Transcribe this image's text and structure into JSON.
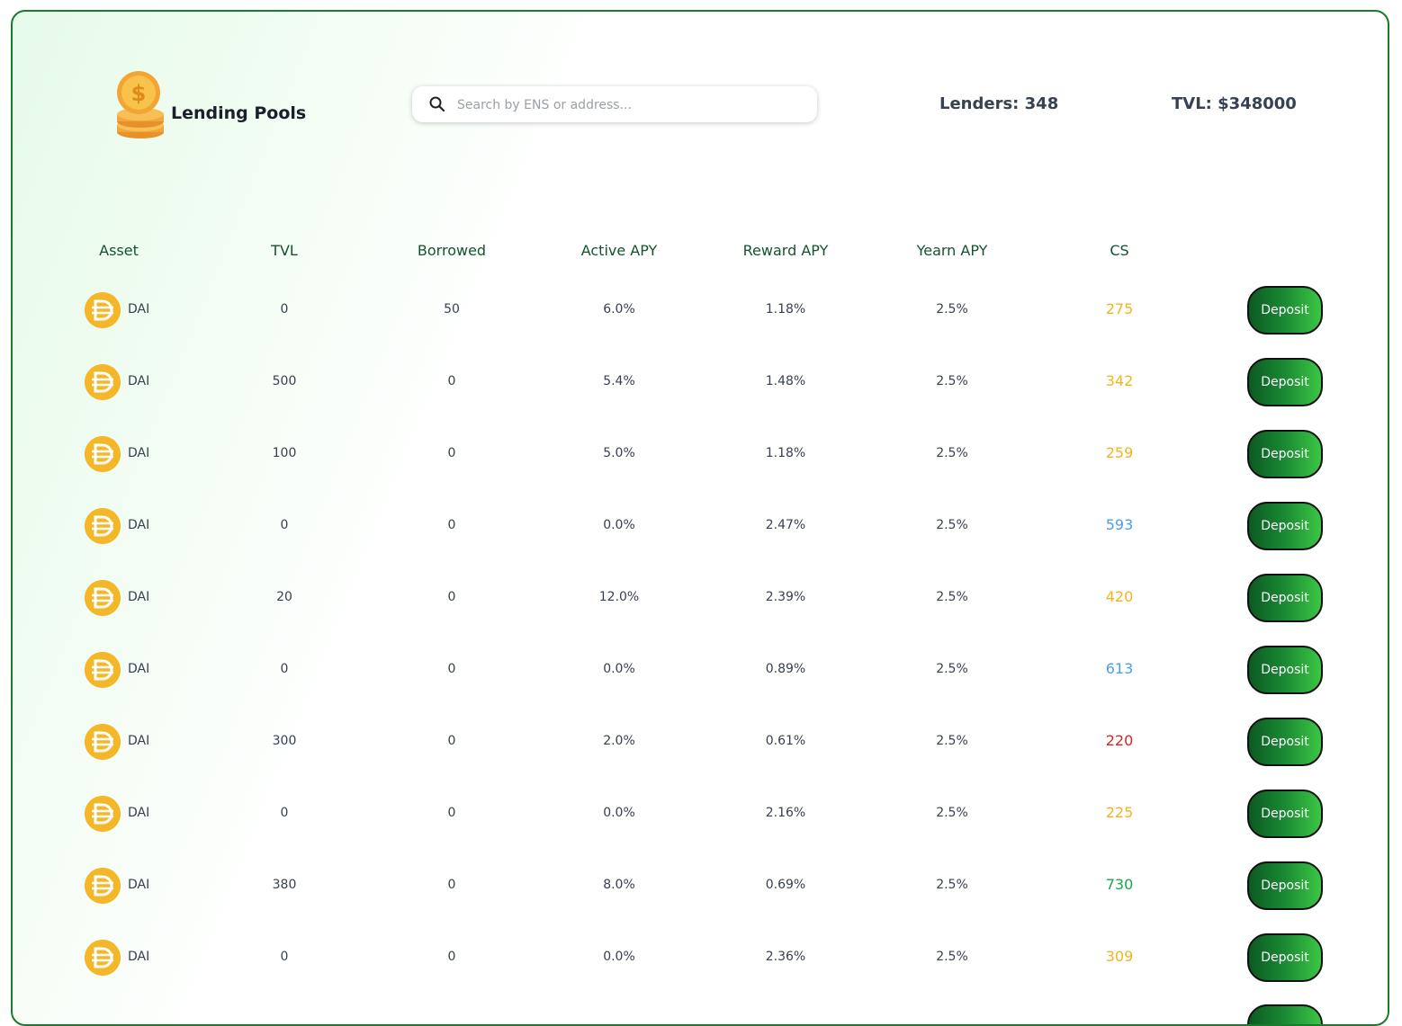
{
  "header": {
    "title": "Lending Pools",
    "search_placeholder": "Search by ENS or address...",
    "lenders": "Lenders: 348",
    "tvl": "TVL: $348000"
  },
  "colors": {
    "accent_green": "#1b7a2c",
    "cs_yellow": "#f4b41a",
    "cs_blue": "#4a9df0",
    "cs_red": "#d32626",
    "cs_green": "#18a84a"
  },
  "table": {
    "columns": [
      "Asset",
      "TVL",
      "Borrowed",
      "Active APY",
      "Reward APY",
      "Yearn APY",
      "CS"
    ],
    "rows": [
      {
        "asset": "DAI",
        "tvl": "0",
        "borrowed": "50",
        "active_apy": "6.0%",
        "reward_apy": "1.18%",
        "yearn_apy": "2.5%",
        "cs": "275",
        "cs_color": "#f4b41a",
        "action": "Deposit"
      },
      {
        "asset": "DAI",
        "tvl": "500",
        "borrowed": "0",
        "active_apy": "5.4%",
        "reward_apy": "1.48%",
        "yearn_apy": "2.5%",
        "cs": "342",
        "cs_color": "#f4b41a",
        "action": "Deposit"
      },
      {
        "asset": "DAI",
        "tvl": "100",
        "borrowed": "0",
        "active_apy": "5.0%",
        "reward_apy": "1.18%",
        "yearn_apy": "2.5%",
        "cs": "259",
        "cs_color": "#f4b41a",
        "action": "Deposit"
      },
      {
        "asset": "DAI",
        "tvl": "0",
        "borrowed": "0",
        "active_apy": "0.0%",
        "reward_apy": "2.47%",
        "yearn_apy": "2.5%",
        "cs": "593",
        "cs_color": "#4a9df0",
        "action": "Deposit"
      },
      {
        "asset": "DAI",
        "tvl": "20",
        "borrowed": "0",
        "active_apy": "12.0%",
        "reward_apy": "2.39%",
        "yearn_apy": "2.5%",
        "cs": "420",
        "cs_color": "#f4b41a",
        "action": "Deposit"
      },
      {
        "asset": "DAI",
        "tvl": "0",
        "borrowed": "0",
        "active_apy": "0.0%",
        "reward_apy": "0.89%",
        "yearn_apy": "2.5%",
        "cs": "613",
        "cs_color": "#4a9df0",
        "action": "Deposit"
      },
      {
        "asset": "DAI",
        "tvl": "300",
        "borrowed": "0",
        "active_apy": "2.0%",
        "reward_apy": "0.61%",
        "yearn_apy": "2.5%",
        "cs": "220",
        "cs_color": "#d32626",
        "action": "Deposit"
      },
      {
        "asset": "DAI",
        "tvl": "0",
        "borrowed": "0",
        "active_apy": "0.0%",
        "reward_apy": "2.16%",
        "yearn_apy": "2.5%",
        "cs": "225",
        "cs_color": "#f4b41a",
        "action": "Deposit"
      },
      {
        "asset": "DAI",
        "tvl": "380",
        "borrowed": "0",
        "active_apy": "8.0%",
        "reward_apy": "0.69%",
        "yearn_apy": "2.5%",
        "cs": "730",
        "cs_color": "#18a84a",
        "action": "Deposit"
      },
      {
        "asset": "DAI",
        "tvl": "0",
        "borrowed": "0",
        "active_apy": "0.0%",
        "reward_apy": "2.36%",
        "yearn_apy": "2.5%",
        "cs": "309",
        "cs_color": "#f4b41a",
        "action": "Deposit"
      }
    ]
  }
}
